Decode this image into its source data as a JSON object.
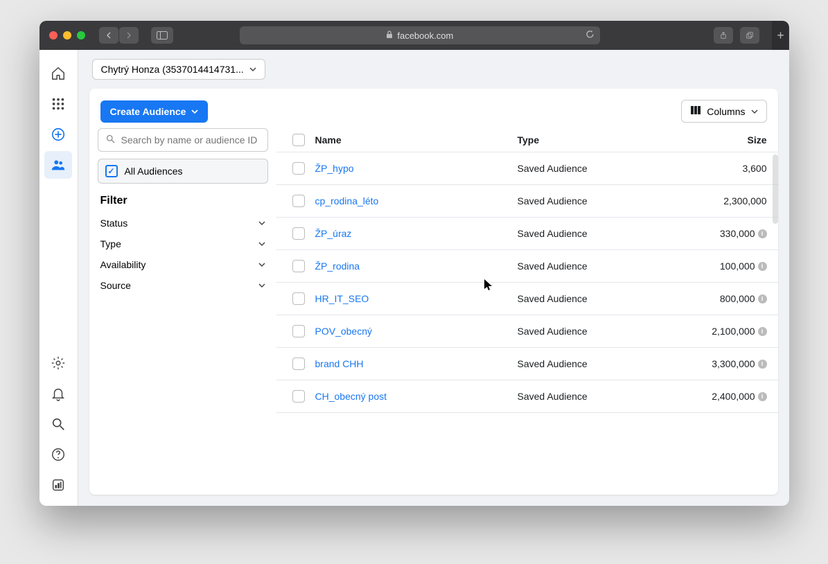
{
  "browser": {
    "url_host": "facebook.com"
  },
  "account": {
    "label": "Chytrý Honza (3537014414731..."
  },
  "buttons": {
    "create_audience": "Create Audience",
    "columns": "Columns"
  },
  "search": {
    "placeholder": "Search by name or audience ID"
  },
  "sidebar": {
    "all_audiences": "All Audiences",
    "filter_heading": "Filter",
    "filters": [
      {
        "label": "Status"
      },
      {
        "label": "Type"
      },
      {
        "label": "Availability"
      },
      {
        "label": "Source"
      }
    ]
  },
  "table": {
    "headers": {
      "name": "Name",
      "type": "Type",
      "size": "Size"
    },
    "rows": [
      {
        "name": "ŽP_hypo",
        "type": "Saved Audience",
        "size": "3,600",
        "info": false
      },
      {
        "name": "cp_rodina_léto",
        "type": "Saved Audience",
        "size": "2,300,000",
        "info": false
      },
      {
        "name": "ŽP_úraz",
        "type": "Saved Audience",
        "size": "330,000",
        "info": true
      },
      {
        "name": "ŽP_rodina",
        "type": "Saved Audience",
        "size": "100,000",
        "info": true
      },
      {
        "name": "HR_IT_SEO",
        "type": "Saved Audience",
        "size": "800,000",
        "info": true
      },
      {
        "name": "POV_obecný",
        "type": "Saved Audience",
        "size": "2,100,000",
        "info": true
      },
      {
        "name": "brand CHH",
        "type": "Saved Audience",
        "size": "3,300,000",
        "info": true
      },
      {
        "name": "CH_obecný post",
        "type": "Saved Audience",
        "size": "2,400,000",
        "info": true
      }
    ]
  }
}
